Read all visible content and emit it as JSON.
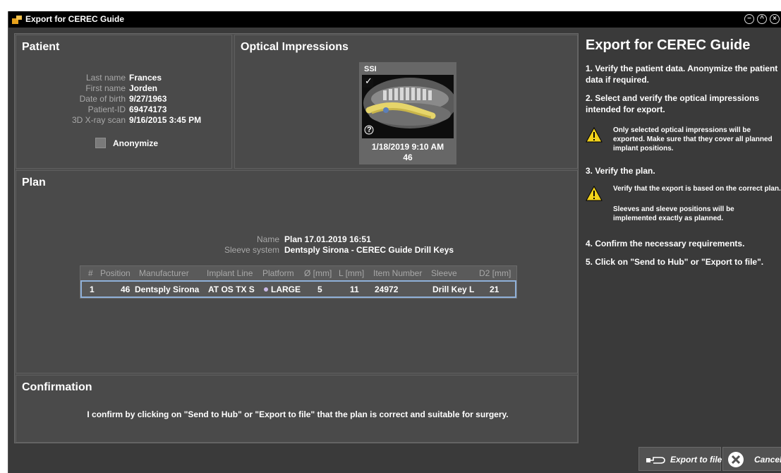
{
  "window": {
    "title": "Export for CEREC Guide"
  },
  "patient": {
    "title": "Patient",
    "fields": [
      {
        "label": "Last name",
        "value": "Frances"
      },
      {
        "label": "First name",
        "value": "Jorden"
      },
      {
        "label": "Date of birth",
        "value": "9/27/1963"
      },
      {
        "label": "Patient-ID",
        "value": "69474173"
      },
      {
        "label": "3D X-ray scan",
        "value": "9/16/2015 3:45 PM"
      }
    ],
    "anonymize_label": "Anonymize"
  },
  "optical": {
    "title": "Optical Impressions",
    "item": {
      "name": "SSI",
      "date": "1/18/2019 9:10 AM",
      "position": "46",
      "check": "✓",
      "help": "?"
    }
  },
  "plan": {
    "title": "Plan",
    "name_label": "Name",
    "name_value": "Plan 17.01.2019 16:51",
    "sleeve_label": "Sleeve system",
    "sleeve_value": "Dentsply Sirona - CEREC Guide Drill Keys",
    "columns": [
      "#",
      "Position",
      "Manufacturer",
      "Implant Line",
      "Platform",
      "Ø [mm]",
      "L [mm]",
      "Item Number",
      "Sleeve",
      "D2 [mm]"
    ],
    "rows": [
      [
        "1",
        "46",
        "Dentsply Sirona",
        "AT OS TX S",
        "LARGE",
        "5",
        "11",
        "24972",
        "Drill Key L",
        "21"
      ]
    ]
  },
  "confirmation": {
    "title": "Confirmation",
    "text": "I confirm by clicking on \"Send to Hub\" or \"Export to file\" that the plan is correct and suitable for surgery."
  },
  "instructions": {
    "title": "Export for CEREC Guide",
    "step1": "1. Verify the patient data. Anonymize the patient data if required.",
    "step2": "2. Select and verify the optical impressions intended for export.",
    "warn1": "Only selected optical impressions will be exported. Make sure that they cover all planned implant positions.",
    "step3": "3. Verify the plan.",
    "warn2a": "Verify that the export is based on the correct plan.",
    "warn2b": "Sleeves and sleeve positions will be implemented exactly as planned.",
    "step4": "4. Confirm the necessary requirements.",
    "step5": "5. Click on \"Send to Hub\" or \"Export to file\"."
  },
  "buttons": {
    "export": "Export to file",
    "cancel": "Cancel"
  },
  "colors": {
    "accent_row_border": "#8fb0d8",
    "warning": "#f2d21b",
    "platform_dot": "#c9b8e6"
  }
}
